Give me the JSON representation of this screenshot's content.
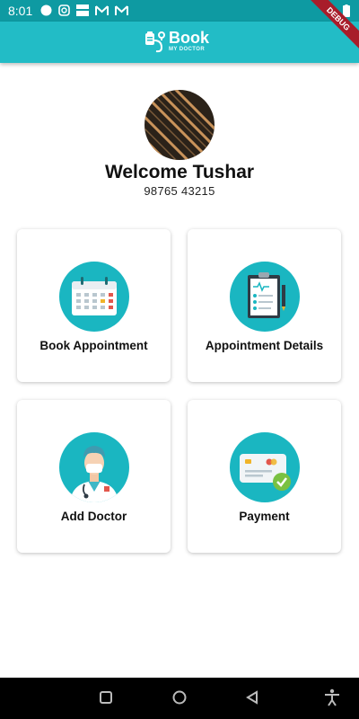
{
  "status_bar": {
    "time": "8:01"
  },
  "app_bar": {
    "logo_title": "Book",
    "logo_subtitle": "MY DOCTOR",
    "debug_label": "DEBUG"
  },
  "profile": {
    "welcome": "Welcome Tushar",
    "phone": "98765 43215"
  },
  "menu": {
    "items": [
      {
        "label": "Book Appointment",
        "icon": "calendar-icon"
      },
      {
        "label": "Appointment Details",
        "icon": "clipboard-icon"
      },
      {
        "label": "Add Doctor",
        "icon": "doctor-icon"
      },
      {
        "label": "Payment",
        "icon": "credit-card-icon"
      }
    ]
  },
  "colors": {
    "status_bar": "#0e9aa2",
    "app_bar": "#22bcc6",
    "icon_circle": "#1ab6c1",
    "debug_ribbon": "#a81d2a"
  },
  "nav": {
    "buttons": [
      "recents-icon",
      "home-icon",
      "back-icon",
      "accessibility-icon"
    ]
  }
}
